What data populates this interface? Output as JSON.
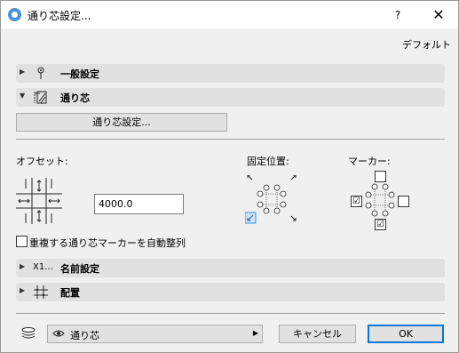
{
  "window": {
    "title": "通り芯設定...",
    "help_label": "?",
    "close_label": "✕",
    "icon": "archicad-logo-icon"
  },
  "default_label": "デフォルト",
  "sections": {
    "general": {
      "label": "一般設定",
      "icon": "pin-icon",
      "expanded": false
    },
    "grid": {
      "label": "通り芯",
      "icon": "grid-axis-icon",
      "expanded": true
    },
    "naming": {
      "label": "名前設定",
      "prefix": "X1...",
      "icon": "naming-icon",
      "expanded": false
    },
    "placement": {
      "label": "配置",
      "icon": "placement-grid-icon",
      "expanded": false
    }
  },
  "grid_settings_button": "通り芯設定...",
  "offset": {
    "label": "オフセット:",
    "value": "4000.0"
  },
  "anchor": {
    "label": "固定位置:",
    "selected": "bottom-left"
  },
  "markers": {
    "label": "マーカー:",
    "top": false,
    "left": true,
    "right": false,
    "bottom": true,
    "left_mark": "☑",
    "bottom_mark": "☑"
  },
  "auto_arrange": {
    "label": "重複する通り芯マーカーを自動整列",
    "checked": false
  },
  "layer": {
    "value": "通り芯",
    "icon": "layers-icon"
  },
  "cancel_label": "キャンセル",
  "ok_label": "OK",
  "colors": {
    "accent": "#0078d7",
    "section_bg": "#e1e1e1",
    "dialog_bg": "#f0f0f0"
  }
}
